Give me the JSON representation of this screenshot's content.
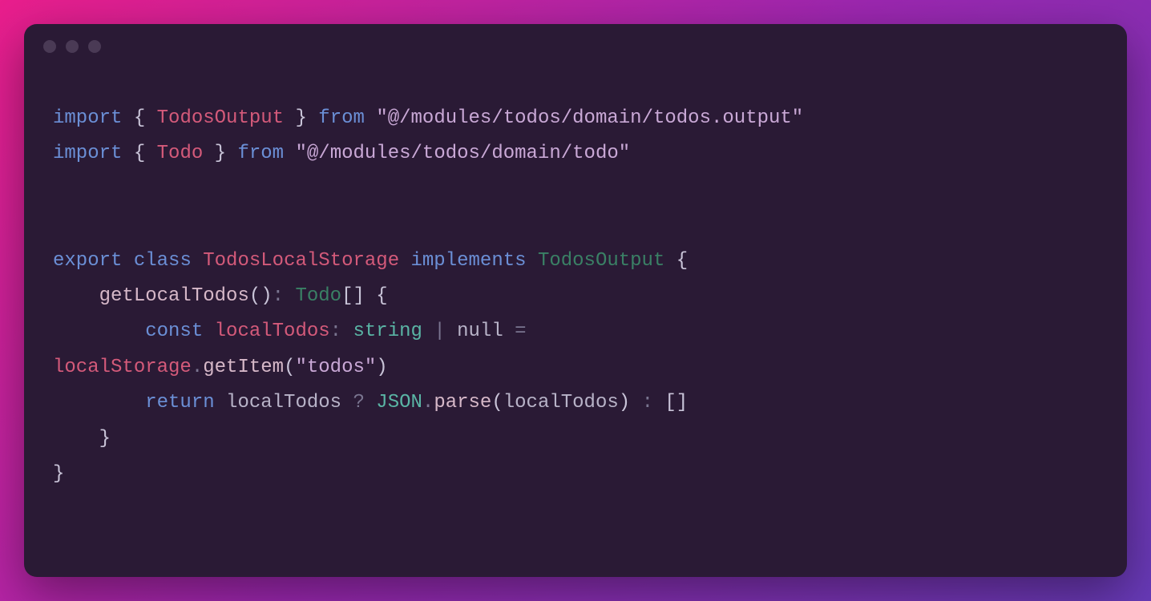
{
  "code": {
    "tokens": [
      {
        "t": "import",
        "c": "kw"
      },
      {
        "t": " ",
        "c": ""
      },
      {
        "t": "{",
        "c": "brace"
      },
      {
        "t": " ",
        "c": ""
      },
      {
        "t": "TodosOutput",
        "c": "type-name"
      },
      {
        "t": " ",
        "c": ""
      },
      {
        "t": "}",
        "c": "brace"
      },
      {
        "t": " ",
        "c": ""
      },
      {
        "t": "from",
        "c": "kw"
      },
      {
        "t": " ",
        "c": ""
      },
      {
        "t": "\"@/modules/todos/domain/todos.output\"",
        "c": "str"
      },
      {
        "t": "\n",
        "c": ""
      },
      {
        "t": "import",
        "c": "kw"
      },
      {
        "t": " ",
        "c": ""
      },
      {
        "t": "{",
        "c": "brace"
      },
      {
        "t": " ",
        "c": ""
      },
      {
        "t": "Todo",
        "c": "type-name"
      },
      {
        "t": " ",
        "c": ""
      },
      {
        "t": "}",
        "c": "brace"
      },
      {
        "t": " ",
        "c": ""
      },
      {
        "t": "from",
        "c": "kw"
      },
      {
        "t": " ",
        "c": ""
      },
      {
        "t": "\"@/modules/todos/domain/todo\"",
        "c": "str"
      },
      {
        "t": "\n",
        "c": ""
      },
      {
        "t": "\n",
        "c": ""
      },
      {
        "t": "\n",
        "c": ""
      },
      {
        "t": "export",
        "c": "kw"
      },
      {
        "t": " ",
        "c": ""
      },
      {
        "t": "class",
        "c": "cls-kw"
      },
      {
        "t": " ",
        "c": ""
      },
      {
        "t": "TodosLocalStorage",
        "c": "type-name"
      },
      {
        "t": " ",
        "c": ""
      },
      {
        "t": "implements",
        "c": "kw"
      },
      {
        "t": " ",
        "c": ""
      },
      {
        "t": "TodosOutput",
        "c": "type-ref"
      },
      {
        "t": " ",
        "c": ""
      },
      {
        "t": "{",
        "c": "brace"
      },
      {
        "t": "\n",
        "c": ""
      },
      {
        "t": "    ",
        "c": ""
      },
      {
        "t": "getLocalTodos",
        "c": "fn"
      },
      {
        "t": "()",
        "c": "brace"
      },
      {
        "t": ":",
        "c": "punct"
      },
      {
        "t": " ",
        "c": ""
      },
      {
        "t": "Todo",
        "c": "type-ref"
      },
      {
        "t": "[]",
        "c": "brace"
      },
      {
        "t": " ",
        "c": ""
      },
      {
        "t": "{",
        "c": "brace"
      },
      {
        "t": "\n",
        "c": ""
      },
      {
        "t": "        ",
        "c": ""
      },
      {
        "t": "const",
        "c": "kw"
      },
      {
        "t": " ",
        "c": ""
      },
      {
        "t": "localTodos",
        "c": "prop"
      },
      {
        "t": ":",
        "c": "punct"
      },
      {
        "t": " ",
        "c": ""
      },
      {
        "t": "string",
        "c": "type-prim"
      },
      {
        "t": " ",
        "c": ""
      },
      {
        "t": "|",
        "c": "pipe"
      },
      {
        "t": " ",
        "c": ""
      },
      {
        "t": "null",
        "c": "null-kw"
      },
      {
        "t": " ",
        "c": ""
      },
      {
        "t": "=",
        "c": "punct"
      },
      {
        "t": " \n",
        "c": ""
      },
      {
        "t": "localStorage",
        "c": "prop"
      },
      {
        "t": ".",
        "c": "punct"
      },
      {
        "t": "getItem",
        "c": "method"
      },
      {
        "t": "(",
        "c": "brace"
      },
      {
        "t": "\"todos\"",
        "c": "str"
      },
      {
        "t": ")",
        "c": "brace"
      },
      {
        "t": "\n",
        "c": ""
      },
      {
        "t": "        ",
        "c": ""
      },
      {
        "t": "return",
        "c": "kw"
      },
      {
        "t": " ",
        "c": ""
      },
      {
        "t": "localTodos",
        "c": "ident"
      },
      {
        "t": " ",
        "c": ""
      },
      {
        "t": "?",
        "c": "punct"
      },
      {
        "t": " ",
        "c": ""
      },
      {
        "t": "JSON",
        "c": "json-cls"
      },
      {
        "t": ".",
        "c": "punct"
      },
      {
        "t": "parse",
        "c": "method"
      },
      {
        "t": "(",
        "c": "brace"
      },
      {
        "t": "localTodos",
        "c": "ident"
      },
      {
        "t": ")",
        "c": "brace"
      },
      {
        "t": " ",
        "c": ""
      },
      {
        "t": ":",
        "c": "punct"
      },
      {
        "t": " ",
        "c": ""
      },
      {
        "t": "[]",
        "c": "brace"
      },
      {
        "t": "\n",
        "c": ""
      },
      {
        "t": "    ",
        "c": ""
      },
      {
        "t": "}",
        "c": "brace"
      },
      {
        "t": "\n",
        "c": ""
      },
      {
        "t": "}",
        "c": "brace"
      }
    ]
  }
}
